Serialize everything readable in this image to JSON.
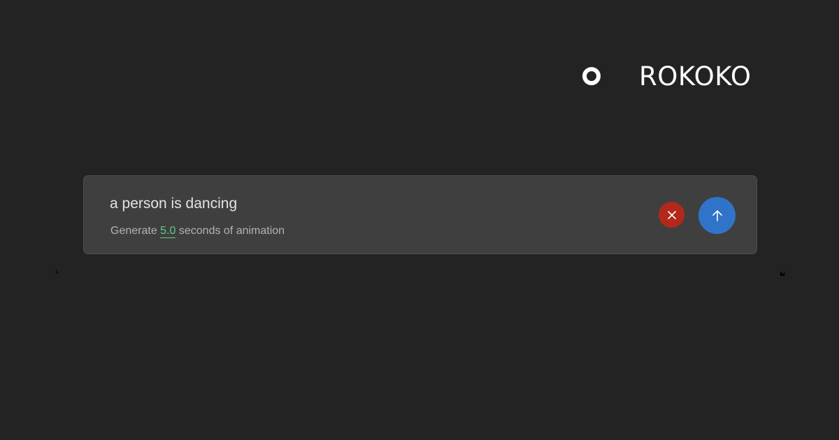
{
  "brand": {
    "logo_icon": "ring-icon",
    "name": "ROKOKO"
  },
  "prompt": {
    "text": "a person is dancing",
    "duration_prefix": "Generate",
    "duration_value": "5.0",
    "duration_suffix": "seconds of animation"
  },
  "actions": {
    "clear_icon": "close-icon",
    "submit_icon": "arrow-up-icon"
  },
  "colors": {
    "background": "#232323",
    "panel": "#3f3f3f",
    "accent_green": "#62c98a",
    "clear_red": "#b3281a",
    "submit_blue": "#2f74c9"
  }
}
